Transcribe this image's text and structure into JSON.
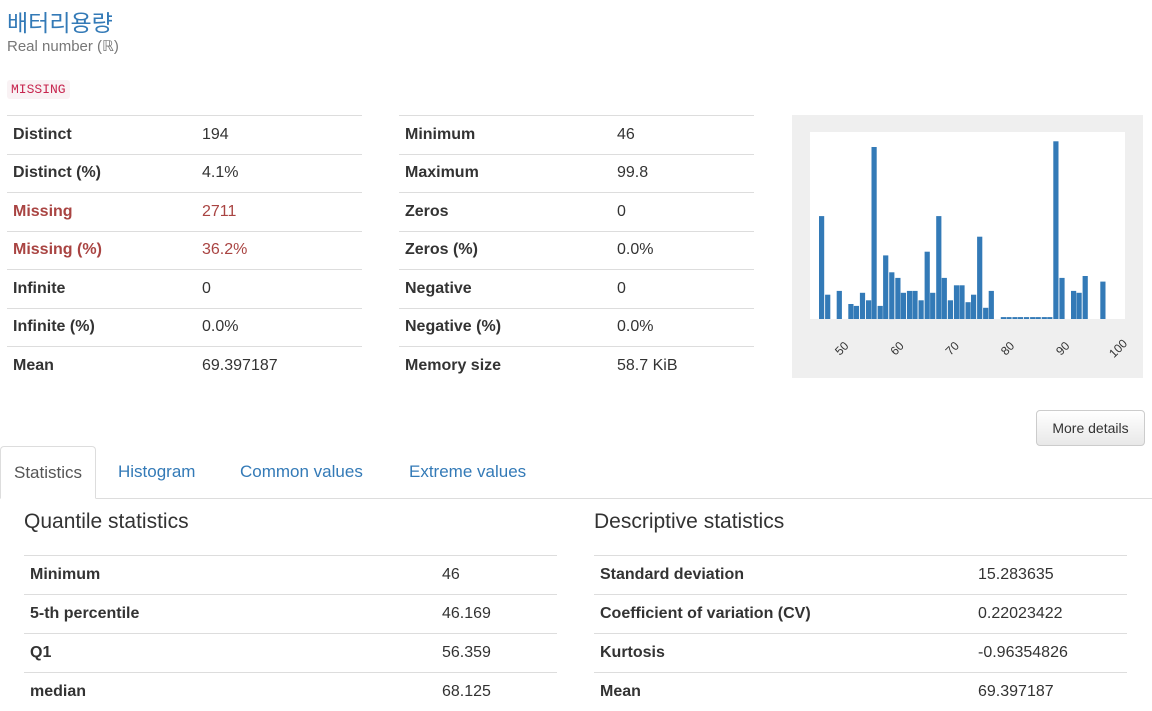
{
  "variable": {
    "title": "배터리용량",
    "subtitle": "Real number (ℝ)",
    "missing_badge": "MISSING"
  },
  "stats_left": [
    {
      "label": "Distinct",
      "value": "194",
      "alert": false
    },
    {
      "label": "Distinct (%)",
      "value": "4.1%",
      "alert": false
    },
    {
      "label": "Missing",
      "value": "2711",
      "alert": true
    },
    {
      "label": "Missing (%)",
      "value": "36.2%",
      "alert": true
    },
    {
      "label": "Infinite",
      "value": "0",
      "alert": false
    },
    {
      "label": "Infinite (%)",
      "value": "0.0%",
      "alert": false
    },
    {
      "label": "Mean",
      "value": "69.397187",
      "alert": false
    }
  ],
  "stats_right": [
    {
      "label": "Minimum",
      "value": "46"
    },
    {
      "label": "Maximum",
      "value": "99.8"
    },
    {
      "label": "Zeros",
      "value": "0"
    },
    {
      "label": "Zeros (%)",
      "value": "0.0%"
    },
    {
      "label": "Negative",
      "value": "0"
    },
    {
      "label": "Negative (%)",
      "value": "0.0%"
    },
    {
      "label": "Memory size",
      "value": "58.7 KiB"
    }
  ],
  "more_details_label": "More details",
  "tabs": [
    {
      "label": "Statistics",
      "active": true
    },
    {
      "label": "Histogram",
      "active": false
    },
    {
      "label": "Common values",
      "active": false
    },
    {
      "label": "Extreme values",
      "active": false
    }
  ],
  "quantile": {
    "heading": "Quantile statistics",
    "rows": [
      {
        "label": "Minimum",
        "value": "46"
      },
      {
        "label": "5-th percentile",
        "value": "46.169"
      },
      {
        "label": "Q1",
        "value": "56.359"
      },
      {
        "label": "median",
        "value": "68.125"
      }
    ]
  },
  "descriptive": {
    "heading": "Descriptive statistics",
    "rows": [
      {
        "label": "Standard deviation",
        "value": "15.283635"
      },
      {
        "label": "Coefficient of variation (CV)",
        "value": "0.22023422"
      },
      {
        "label": "Kurtosis",
        "value": "-0.96354826"
      },
      {
        "label": "Mean",
        "value": "69.397187"
      }
    ]
  },
  "colors": {
    "bar": "#337ab7",
    "link": "#337ab7",
    "alert": "#a94442"
  },
  "chart_data": {
    "type": "bar",
    "title": "",
    "xlabel": "",
    "ylabel": "",
    "xlim": [
      46,
      99.8
    ],
    "xticks": [
      50,
      60,
      70,
      80,
      90,
      100
    ],
    "grid": false,
    "bins": [
      {
        "x": 46.6,
        "h": 0.55
      },
      {
        "x": 47.7,
        "h": 0.13
      },
      {
        "x": 49.8,
        "h": 0.15
      },
      {
        "x": 51.9,
        "h": 0.08
      },
      {
        "x": 52.9,
        "h": 0.07
      },
      {
        "x": 54.0,
        "h": 0.14
      },
      {
        "x": 55.1,
        "h": 0.1
      },
      {
        "x": 56.1,
        "h": 0.92
      },
      {
        "x": 57.2,
        "h": 0.07
      },
      {
        "x": 58.2,
        "h": 0.34
      },
      {
        "x": 59.3,
        "h": 0.25
      },
      {
        "x": 60.4,
        "h": 0.22
      },
      {
        "x": 61.4,
        "h": 0.14
      },
      {
        "x": 62.5,
        "h": 0.15
      },
      {
        "x": 63.5,
        "h": 0.15
      },
      {
        "x": 64.6,
        "h": 0.1
      },
      {
        "x": 65.7,
        "h": 0.36
      },
      {
        "x": 66.7,
        "h": 0.14
      },
      {
        "x": 67.8,
        "h": 0.55
      },
      {
        "x": 68.8,
        "h": 0.22
      },
      {
        "x": 69.9,
        "h": 0.1
      },
      {
        "x": 71.0,
        "h": 0.18
      },
      {
        "x": 72.0,
        "h": 0.18
      },
      {
        "x": 73.1,
        "h": 0.09
      },
      {
        "x": 74.1,
        "h": 0.13
      },
      {
        "x": 75.2,
        "h": 0.44
      },
      {
        "x": 76.3,
        "h": 0.06
      },
      {
        "x": 77.3,
        "h": 0.15
      },
      {
        "x": 79.5,
        "h": 0.01
      },
      {
        "x": 80.5,
        "h": 0.01
      },
      {
        "x": 81.6,
        "h": 0.01
      },
      {
        "x": 82.6,
        "h": 0.01
      },
      {
        "x": 83.7,
        "h": 0.01
      },
      {
        "x": 84.8,
        "h": 0.01
      },
      {
        "x": 85.8,
        "h": 0.01
      },
      {
        "x": 86.9,
        "h": 0.01
      },
      {
        "x": 87.9,
        "h": 0.01
      },
      {
        "x": 89.0,
        "h": 0.95
      },
      {
        "x": 90.1,
        "h": 0.22
      },
      {
        "x": 92.2,
        "h": 0.15
      },
      {
        "x": 93.2,
        "h": 0.14
      },
      {
        "x": 94.3,
        "h": 0.23
      },
      {
        "x": 97.5,
        "h": 0.2
      }
    ]
  }
}
